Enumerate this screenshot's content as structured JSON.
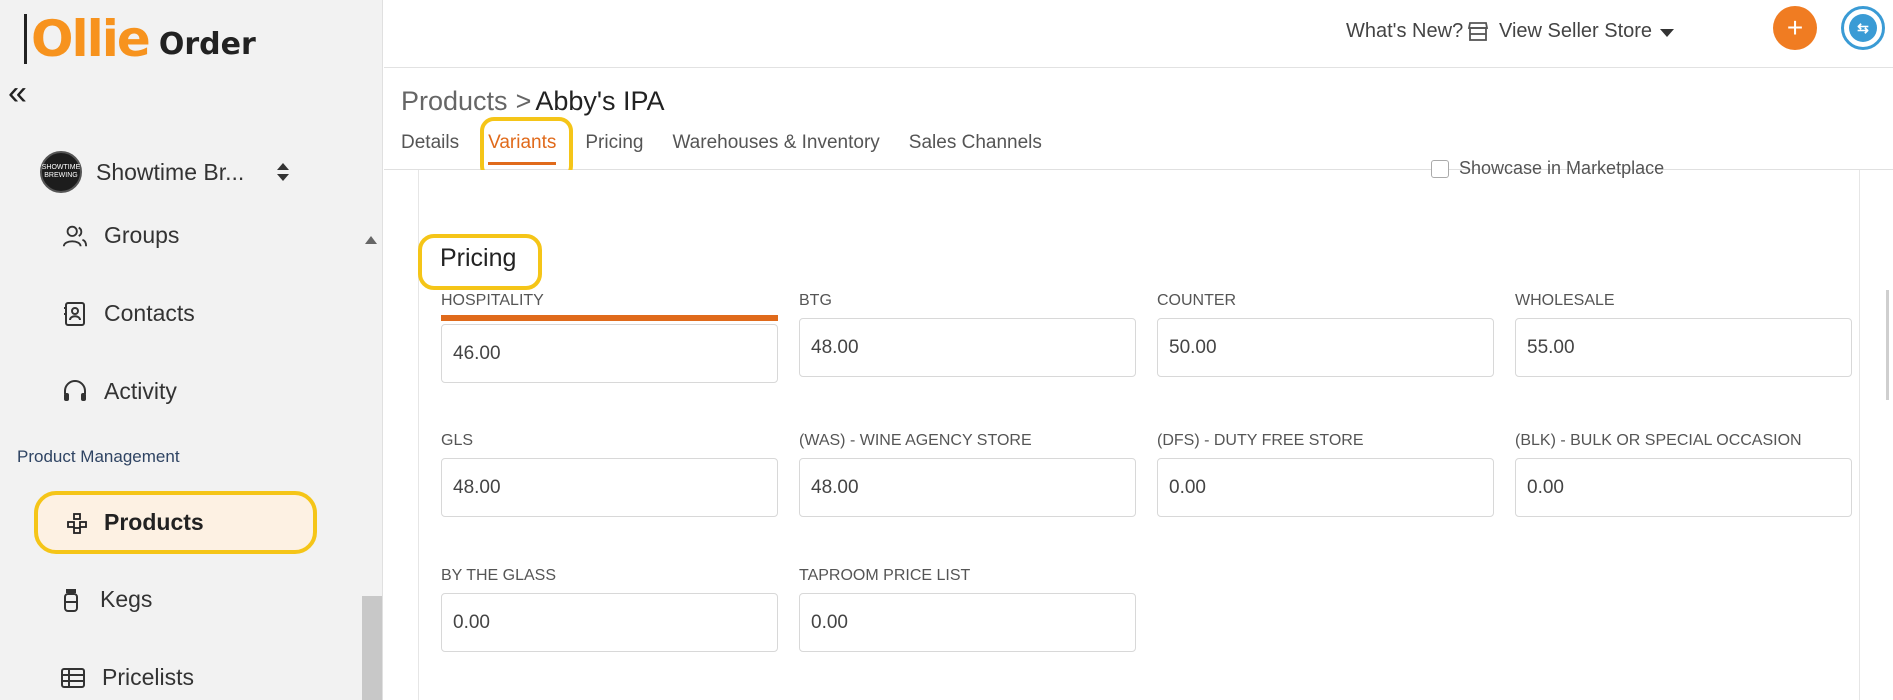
{
  "brand": {
    "logo_mark": "Ollie",
    "logo_text": "Order",
    "collapse_glyph": "«"
  },
  "org": {
    "name": "Showtime Br...",
    "avatar_text": "SHOWTIME BREWING"
  },
  "sidebar": {
    "items": [
      {
        "label": "Groups",
        "icon": "users-icon"
      },
      {
        "label": "Contacts",
        "icon": "contacts-icon"
      },
      {
        "label": "Activity",
        "icon": "headset-icon"
      }
    ],
    "section_label": "Product Management",
    "products_label": "Products",
    "lower_items": [
      {
        "label": "Kegs",
        "icon": "keg-icon"
      },
      {
        "label": "Pricelists",
        "icon": "table-icon"
      }
    ]
  },
  "header": {
    "whats_new": "What's New?",
    "view_store": "View Seller Store",
    "plus": "+",
    "user_initial": "⇆"
  },
  "breadcrumb": {
    "root": "Products",
    "separator": ">",
    "current": "Abby's IPA"
  },
  "tabs": [
    {
      "label": "Details",
      "active": false
    },
    {
      "label": "Variants",
      "active": true
    },
    {
      "label": "Pricing",
      "active": false
    },
    {
      "label": "Warehouses & Inventory",
      "active": false
    },
    {
      "label": "Sales Channels",
      "active": false
    }
  ],
  "showcase_label": "Showcase in Marketplace",
  "pricing": {
    "title": "Pricing",
    "fields": [
      {
        "label": "HOSPITALITY",
        "value": "46.00",
        "focused": true
      },
      {
        "label": "BTG",
        "value": "48.00"
      },
      {
        "label": "COUNTER",
        "value": "50.00"
      },
      {
        "label": "WHOLESALE",
        "value": "55.00"
      },
      {
        "label": "GLS",
        "value": "48.00"
      },
      {
        "label": "(WAS) - WINE AGENCY STORE",
        "value": "48.00"
      },
      {
        "label": "(DFS) - DUTY FREE STORE",
        "value": "0.00"
      },
      {
        "label": "(BLK) - BULK OR SPECIAL OCCASION",
        "value": "0.00"
      },
      {
        "label": "BY THE GLASS",
        "value": "0.00"
      },
      {
        "label": "TAPROOM PRICE LIST",
        "value": "0.00"
      }
    ]
  },
  "colors": {
    "accent": "#e06a1b",
    "highlight": "#f5c518",
    "plus_button": "#f07c22",
    "user_ring": "#3a9bd5"
  }
}
